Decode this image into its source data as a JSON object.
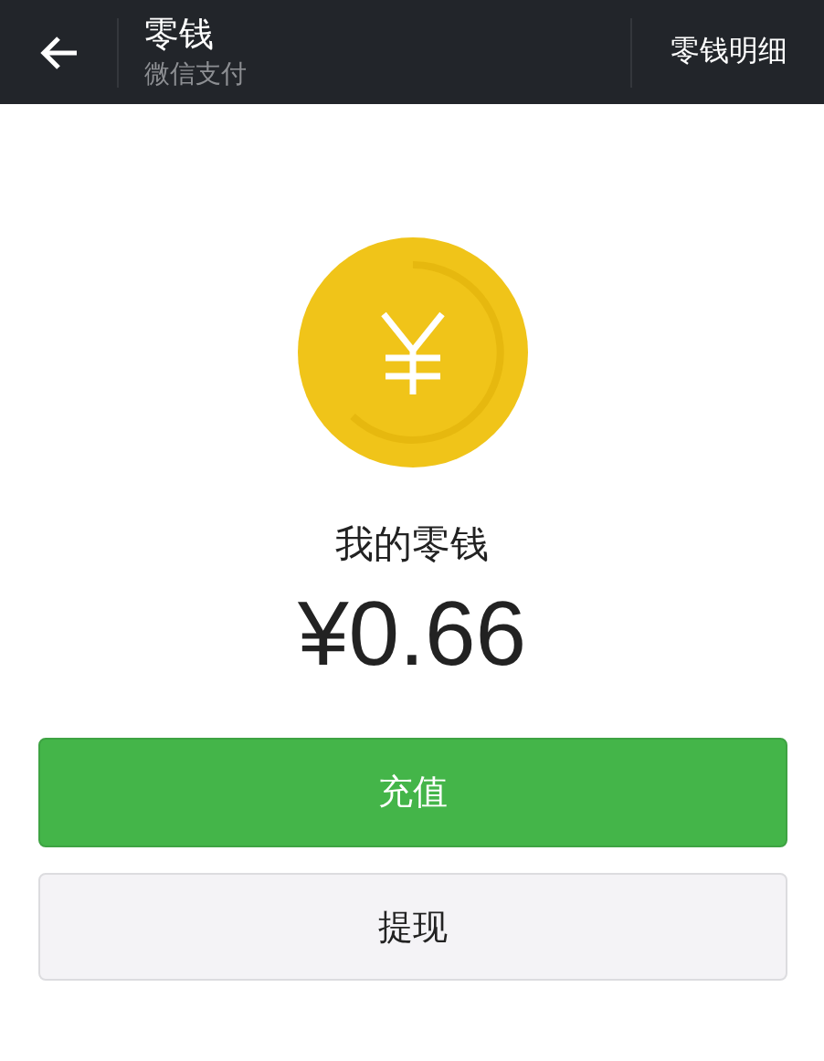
{
  "header": {
    "title": "零钱",
    "subtitle": "微信支付",
    "action": "零钱明细"
  },
  "balance": {
    "label": "我的零钱",
    "amount": "¥0.66"
  },
  "buttons": [
    {
      "label": "充值",
      "kind": "primary"
    },
    {
      "label": "提现",
      "kind": "secondary"
    }
  ]
}
